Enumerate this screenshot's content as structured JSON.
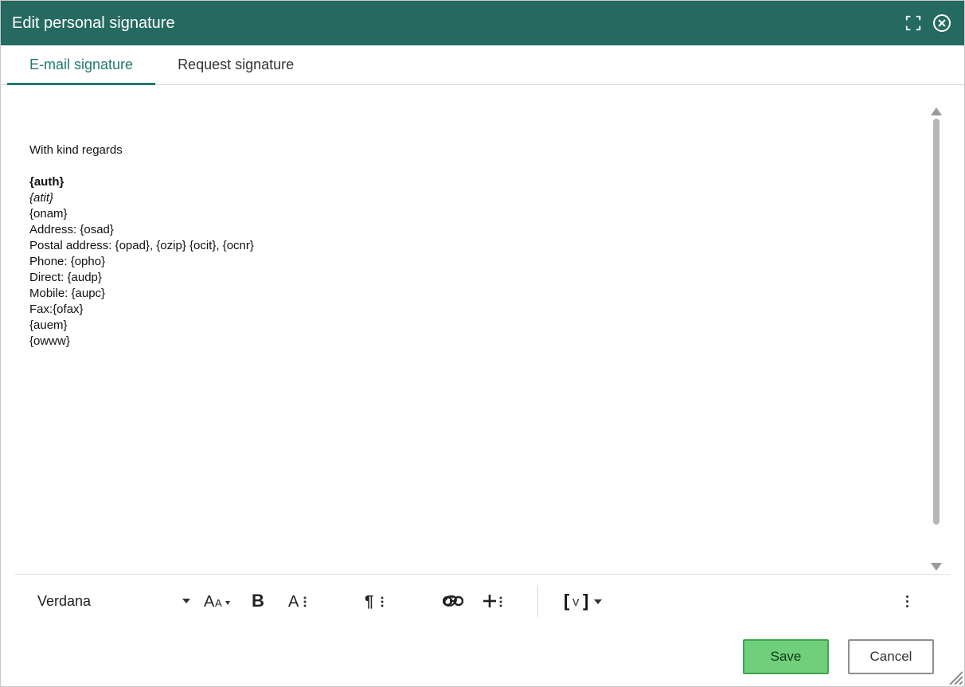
{
  "dialog": {
    "title": "Edit personal signature"
  },
  "tabs": [
    {
      "label": "E-mail signature",
      "active": true
    },
    {
      "label": "Request signature",
      "active": false
    }
  ],
  "editor": {
    "greeting": "With kind regards",
    "blank1": "",
    "auth": "{auth}",
    "atit": "{atit}",
    "onam": "{onam}",
    "address_line": "Address: {osad}",
    "postal_line": "Postal address: {opad}, {ozip} {ocit}, {ocnr}",
    "phone_line": "Phone: {opho}",
    "direct_line": "Direct: {audp}",
    "mobile_line": "Mobile: {aupc}",
    "fax_line": "Fax:{ofax}",
    "auem": "{auem}",
    "owww": "{owww}"
  },
  "toolbar": {
    "font": "Verdana",
    "variable_label": "v"
  },
  "footer": {
    "save": "Save",
    "cancel": "Cancel"
  }
}
